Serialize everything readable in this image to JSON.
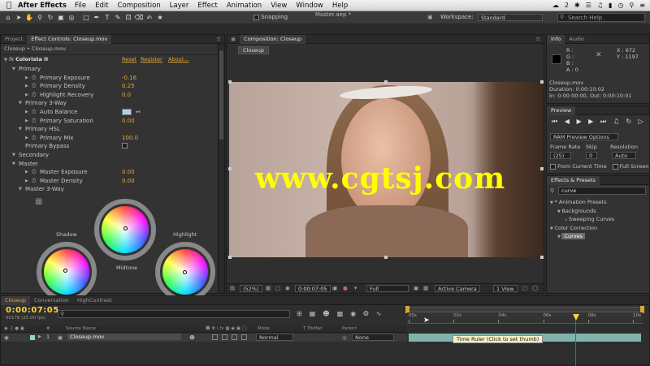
{
  "menubar": {
    "app_name": "After Effects",
    "items": [
      "File",
      "Edit",
      "Composition",
      "Layer",
      "Effect",
      "Animation",
      "View",
      "Window",
      "Help"
    ],
    "status_text": "2"
  },
  "toolbar": {
    "title": "Master.aep *",
    "snapping_label": "Snapping",
    "workspace_label": "Workspace:",
    "workspace_value": "Standard",
    "search_placeholder": "Search Help"
  },
  "effect_controls": {
    "tabs": [
      "Project",
      "Effect Controls: Closeup.mov"
    ],
    "breadcrumb": "Closeup • Closeup.mov",
    "effect_name": "Colorista II",
    "links": [
      "Reset",
      "Register",
      "About..."
    ],
    "rows": [
      {
        "label": "Primary",
        "indent": 1,
        "type": "group"
      },
      {
        "label": "Primary Exposure",
        "indent": 3,
        "value": "-0.16"
      },
      {
        "label": "Primary Density",
        "indent": 3,
        "value": "0.25"
      },
      {
        "label": "Highlight Recovery",
        "indent": 3,
        "value": "0.0"
      },
      {
        "label": "Primary 3-Way",
        "indent": 2,
        "type": "group"
      },
      {
        "label": "Auto Balance",
        "indent": 3,
        "type": "swatch"
      },
      {
        "label": "Primary Saturation",
        "indent": 3,
        "value": "0.00"
      },
      {
        "label": "Primary HSL",
        "indent": 2,
        "type": "group"
      },
      {
        "label": "Primary Mix",
        "indent": 3,
        "value": "100.0"
      },
      {
        "label": "Primary Bypass",
        "indent": 2,
        "type": "checkbox"
      },
      {
        "label": "Secondary",
        "indent": 1,
        "type": "group"
      },
      {
        "label": "Master",
        "indent": 1,
        "type": "group"
      },
      {
        "label": "Master Exposure",
        "indent": 3,
        "value": "0.00"
      },
      {
        "label": "Master Density",
        "indent": 3,
        "value": "0.00"
      },
      {
        "label": "Master 3-Way",
        "indent": 2,
        "type": "group"
      }
    ],
    "wheel_labels": {
      "shadow": "Shadow",
      "midtone": "Midtone",
      "highlight": "Highlight"
    }
  },
  "composition": {
    "tab_label": "Composition: Closeup",
    "sub_tab": "Closeup",
    "watermark": "www.cgtsj.com",
    "footer": {
      "zoom": "(52%)",
      "timecode": "0:00:07:05",
      "resolution": "Full",
      "camera": "Active Camera",
      "view": "1 View"
    }
  },
  "info_panel": {
    "tabs": [
      "Info",
      "Audio"
    ],
    "channels": [
      "R :",
      "G :",
      "B :",
      "A : 0"
    ],
    "coords": [
      "X : 672",
      "Y : 1197"
    ],
    "footage_name": "Closeup.mov",
    "duration": "Duration: 0:00:10:02",
    "in_out": "In: 0:00:00:00, Out: 0:00:10:01"
  },
  "preview_panel": {
    "tab": "Preview",
    "ram_options": "RAM Preview Options",
    "labels": [
      "Frame Rate",
      "Skip",
      "Resolution"
    ],
    "values": [
      "(25)",
      "0",
      "Auto"
    ],
    "from_current": "From Current Time",
    "full_screen": "Full Screen"
  },
  "effects_presets": {
    "tab": "Effects & Presets",
    "search_value": "curve",
    "tree": [
      {
        "label": "* Animation Presets",
        "indent": 0
      },
      {
        "label": "Backgrounds",
        "indent": 1
      },
      {
        "label": "Sweeping Curves",
        "indent": 2
      },
      {
        "label": "Color Correction",
        "indent": 0
      },
      {
        "label": "Curves",
        "indent": 1,
        "selected": true
      }
    ]
  },
  "timeline": {
    "tabs": [
      "Closeup",
      "Conversation",
      "HighContrast"
    ],
    "timecode": "0:00:07:05",
    "frame_info": "00178 (25.00 fps)",
    "ruler_ticks": [
      "00s",
      "02s",
      "04s",
      "06s",
      "08s",
      "10s"
    ],
    "columns": [
      "#",
      "Source Name",
      "Mode",
      "T TrkMat",
      "Parent"
    ],
    "layer": {
      "index": "1",
      "name": "Closeup.mov",
      "mode": "Normal",
      "parent": "None"
    },
    "tooltip": "Time Ruler (Click to set thumb)"
  },
  "colors": {
    "accent_orange": "#e3a53a",
    "playhead_red": "#e52b2b",
    "timecode_yellow": "#ffd23a",
    "watermark": "#ffff00"
  }
}
